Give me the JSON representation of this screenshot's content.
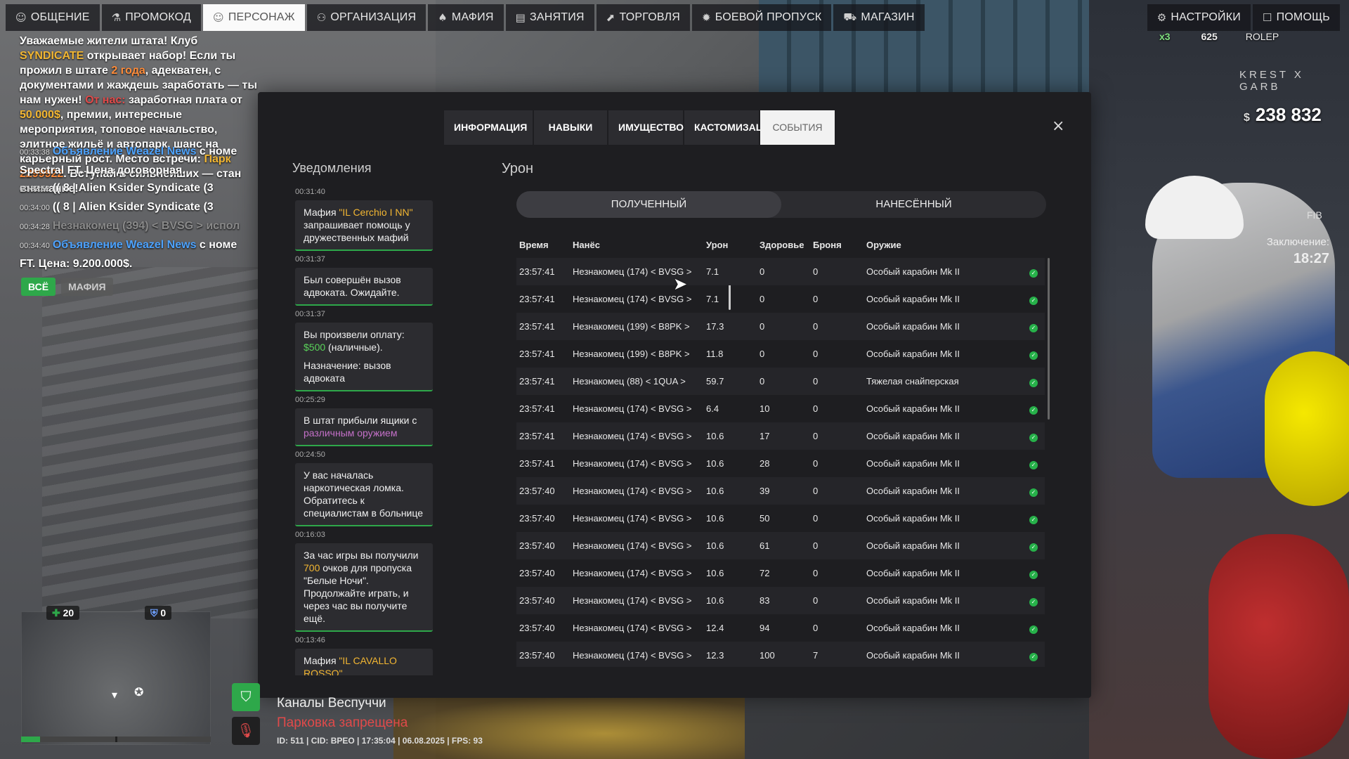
{
  "nav": {
    "left": [
      {
        "label": "ОБЩЕНИЕ",
        "icon": "chat-icon",
        "active": false
      },
      {
        "label": "ПРОМОКОД",
        "icon": "promocode-icon",
        "active": false
      },
      {
        "label": "ПЕРСОНАЖ",
        "icon": "person-icon",
        "active": true
      },
      {
        "label": "ОРГАНИЗАЦИЯ",
        "icon": "organization-icon",
        "active": false
      },
      {
        "label": "МАФИЯ",
        "icon": "mafia-icon",
        "active": false
      },
      {
        "label": "ЗАНЯТИЯ",
        "icon": "activities-icon",
        "active": false
      },
      {
        "label": "ТОРГОВЛЯ",
        "icon": "trade-icon",
        "active": false
      },
      {
        "label": "БОЕВОЙ ПРОПУСК",
        "icon": "battle-pass-icon",
        "active": false
      },
      {
        "label": "МАГАЗИН",
        "icon": "cart-icon",
        "active": false
      }
    ],
    "right": [
      {
        "label": "НАСТРОЙКИ",
        "icon": "gear-icon"
      },
      {
        "label": "ПОМОЩЬ",
        "icon": "help-icon"
      }
    ]
  },
  "chat": {
    "announce": {
      "p1": "Уважаемые жители штата! Клуб ",
      "club": "SYNDICATE",
      "p2": " открывает набор! Если ты прожил в штате ",
      "years": "2 года",
      "p3": ", адекватен, с документами и жаждешь заработать — ты нам нужен! ",
      "from": "От нас:",
      "p4": " заработная плата от ",
      "salary": "50.000$",
      "p5": ", премии, интересные мероприятия, топовое начальство, элитное жильё и автопарк. шанс на карьерный рост. Место встречи: ",
      "place": "Парк",
      "phone": "2299922",
      "p6": ". Вступай в сильнейших — стан",
      "p7": "внимание!"
    },
    "lines": [
      {
        "time": "00:33:38",
        "a": "Объявление Weazel News",
        "b": " с номе"
      },
      {
        "time": "",
        "a": "",
        "b": "Spectral FT. Цена договорная."
      },
      {
        "time": "00:33:52",
        "a": "",
        "b": "(( 8 | Alien Ksider Syndicate (3"
      },
      {
        "time": "00:34:00",
        "a": "",
        "b": "(( 8 | Alien Ksider Syndicate (3"
      },
      {
        "time": "00:34:28",
        "a": "",
        "b": "Незнакомец (394) < BVSG > испол"
      },
      {
        "time": "00:34:40",
        "a": "Объявление Weazel News",
        "b": " с номе"
      },
      {
        "time": "",
        "a": "",
        "b": "FT. Цена: 9.200.000$."
      }
    ],
    "filters": [
      "ВСЁ",
      "МАФИЯ"
    ]
  },
  "hud": {
    "money_sign": "$",
    "money": "238 832",
    "multiplier": "x3",
    "points": "625",
    "role": "ROLEP",
    "server": "KREST X GARB",
    "fib": "FIB",
    "prison_label": "Заключение:",
    "prison_time": "18:27",
    "health": "20",
    "armor": "0"
  },
  "modal": {
    "tabs": [
      "ИНФОРМАЦИЯ",
      "НАВЫКИ",
      "ИМУЩЕСТВО",
      "КАСТОМИЗАЦИЯ",
      "СОБЫТИЯ"
    ],
    "active_tab": 4,
    "close": "×",
    "notifications_title": "Уведомления",
    "damage_title": "Урон",
    "switch": [
      "ПОЛУЧЕННЫЙ",
      "НАНЕСЁННЫЙ"
    ],
    "notifications": [
      {
        "time": "00:31:40",
        "parts": [
          {
            "t": "Мафия ",
            "c": ""
          },
          {
            "t": "\"IL Cerchio I NN\"",
            "c": "y"
          },
          {
            "t": " запрашивает помощь у дружественных мафий",
            "c": ""
          }
        ]
      },
      {
        "time": "00:31:37",
        "parts": [
          {
            "t": "Был совершён вызов адвоката. Ожидайте.",
            "c": ""
          }
        ]
      },
      {
        "time": "00:31:37",
        "parts": [
          {
            "t": "Вы произвели оплату: ",
            "c": ""
          },
          {
            "t": "$500",
            "c": "g"
          },
          {
            "t": " (наличные).",
            "c": ""
          },
          {
            "t": "\n",
            "c": "br"
          },
          {
            "t": "Назначение: вызов адвоката",
            "c": ""
          }
        ]
      },
      {
        "time": "00:25:29",
        "parts": [
          {
            "t": "В штат прибыли ящики с ",
            "c": ""
          },
          {
            "t": "различным оружием",
            "c": "p"
          }
        ]
      },
      {
        "time": "00:24:50",
        "parts": [
          {
            "t": "У вас началась наркотическая ломка. Обратитесь к специалистам в больнице",
            "c": ""
          }
        ]
      },
      {
        "time": "00:16:03",
        "parts": [
          {
            "t": "За час игры вы получили ",
            "c": ""
          },
          {
            "t": "700",
            "c": "y"
          },
          {
            "t": " очков для пропуска \"Белые Ночи\". Продолжайте играть, и через час вы получите ещё.",
            "c": ""
          }
        ]
      },
      {
        "time": "00:13:46",
        "parts": [
          {
            "t": "Мафия ",
            "c": ""
          },
          {
            "t": "\"IL CAVALLO ROSSO\"",
            "c": "y"
          }
        ]
      }
    ],
    "table": {
      "headers": [
        "Время",
        "Нанёс",
        "Урон",
        "Здоровье",
        "Броня",
        "Оружие"
      ],
      "rows": [
        [
          "23:57:41",
          "Незнакомец (174) < BVSG >",
          "7.1",
          "0",
          "0",
          "Особый карабин Mk II"
        ],
        [
          "23:57:41",
          "Незнакомец (174) < BVSG >",
          "7.1",
          "0",
          "0",
          "Особый карабин Mk II"
        ],
        [
          "23:57:41",
          "Незнакомец (199) < B8PK >",
          "17.3",
          "0",
          "0",
          "Особый карабин Mk II"
        ],
        [
          "23:57:41",
          "Незнакомец (199) < B8PK >",
          "11.8",
          "0",
          "0",
          "Особый карабин Mk II"
        ],
        [
          "23:57:41",
          "Незнакомец (88) < 1QUA >",
          "59.7",
          "0",
          "0",
          "Тяжелая снайперская"
        ],
        [
          "23:57:41",
          "Незнакомец (174) < BVSG >",
          "6.4",
          "10",
          "0",
          "Особый карабин Mk II"
        ],
        [
          "23:57:41",
          "Незнакомец (174) < BVSG >",
          "10.6",
          "17",
          "0",
          "Особый карабин Mk II"
        ],
        [
          "23:57:41",
          "Незнакомец (174) < BVSG >",
          "10.6",
          "28",
          "0",
          "Особый карабин Mk II"
        ],
        [
          "23:57:40",
          "Незнакомец (174) < BVSG >",
          "10.6",
          "39",
          "0",
          "Особый карабин Mk II"
        ],
        [
          "23:57:40",
          "Незнакомец (174) < BVSG >",
          "10.6",
          "50",
          "0",
          "Особый карабин Mk II"
        ],
        [
          "23:57:40",
          "Незнакомец (174) < BVSG >",
          "10.6",
          "61",
          "0",
          "Особый карабин Mk II"
        ],
        [
          "23:57:40",
          "Незнакомец (174) < BVSG >",
          "10.6",
          "72",
          "0",
          "Особый карабин Mk II"
        ],
        [
          "23:57:40",
          "Незнакомец (174) < BVSG >",
          "10.6",
          "83",
          "0",
          "Особый карабин Mk II"
        ],
        [
          "23:57:40",
          "Незнакомец (174) < BVSG >",
          "12.4",
          "94",
          "0",
          "Особый карабин Mk II"
        ],
        [
          "23:57:40",
          "Незнакомец (174) < BVSG >",
          "12.3",
          "100",
          "7",
          "Особый карабин Mk II"
        ]
      ]
    }
  },
  "location": {
    "name": "Каналы Веспуччи",
    "parking": "Парковка запрещена",
    "info": "ID: 511 | CID: BPEO | 17:35:04  | 06.08.2025 | FPS: 93"
  }
}
